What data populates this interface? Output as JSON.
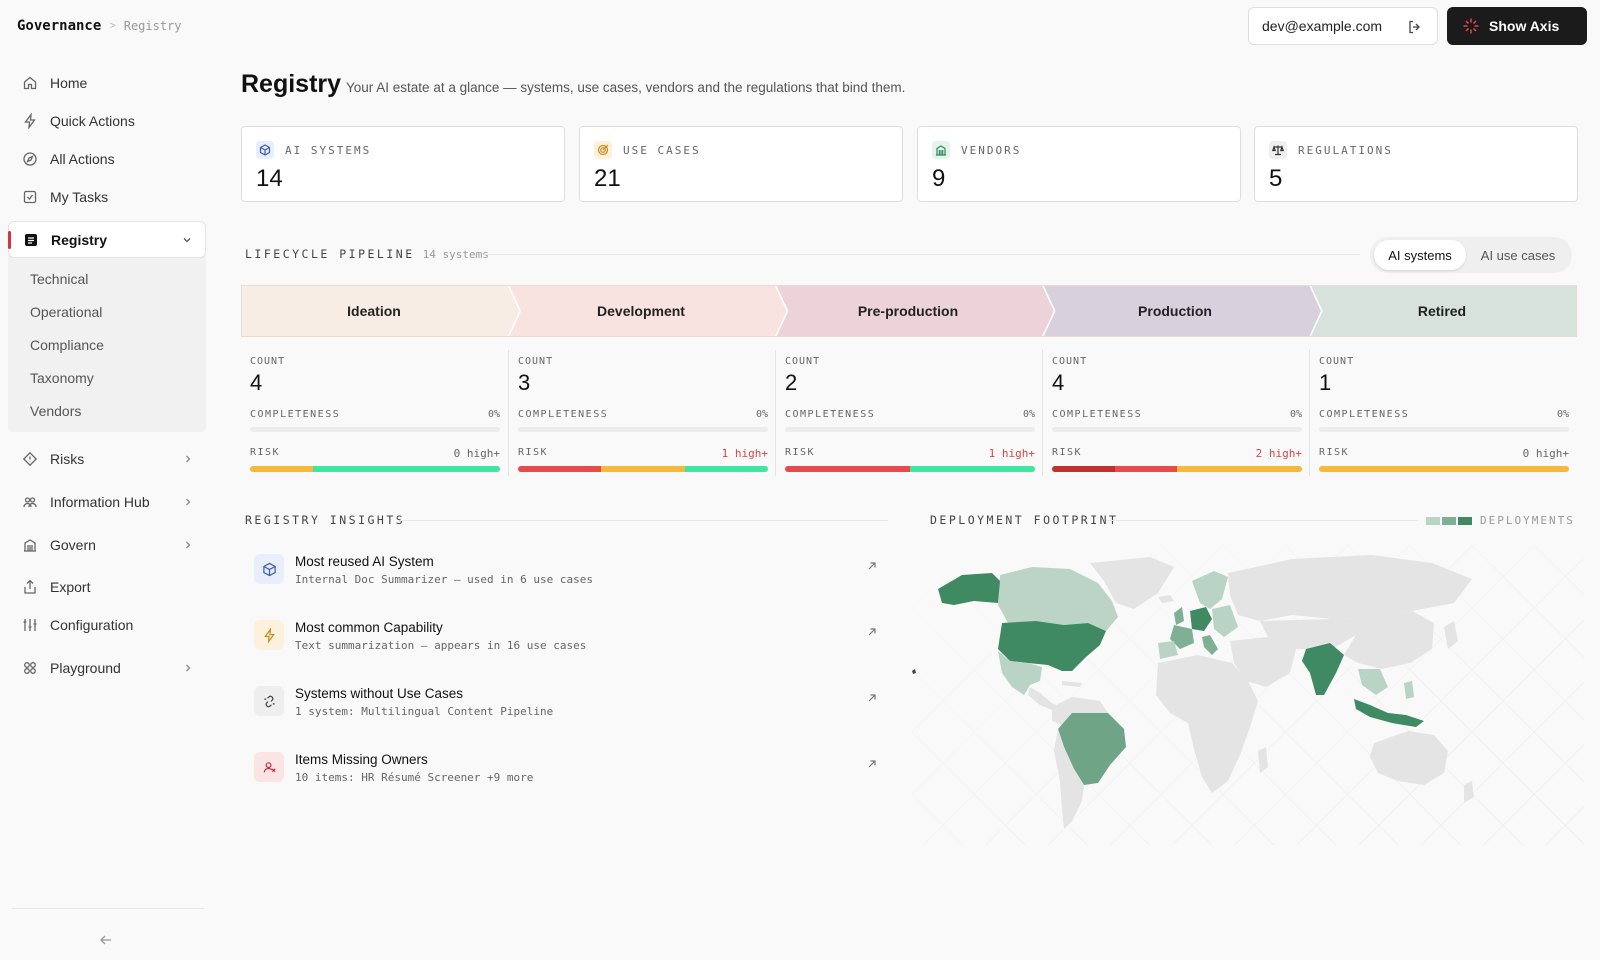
{
  "breadcrumb": {
    "root": "Governance",
    "current": "Registry"
  },
  "sidebar": {
    "items": [
      {
        "label": "Home",
        "icon": "home-icon"
      },
      {
        "label": "Quick Actions",
        "icon": "bolt-icon"
      },
      {
        "label": "All Actions",
        "icon": "compass-icon"
      },
      {
        "label": "My Tasks",
        "icon": "checkbox-icon"
      }
    ],
    "registry": {
      "label": "Registry",
      "children": [
        "Technical",
        "Operational",
        "Compliance",
        "Taxonomy",
        "Vendors"
      ]
    },
    "lower_items": [
      {
        "label": "Risks",
        "icon": "diamond-icon",
        "expandable": true
      },
      {
        "label": "Information Hub",
        "icon": "people-icon",
        "expandable": true
      },
      {
        "label": "Govern",
        "icon": "building-icon",
        "expandable": true
      },
      {
        "label": "Export",
        "icon": "export-icon",
        "expandable": false
      },
      {
        "label": "Configuration",
        "icon": "sliders-icon",
        "expandable": false
      },
      {
        "label": "Playground",
        "icon": "grid-icon",
        "expandable": true
      }
    ]
  },
  "topbar": {
    "user_email": "dev@example.com",
    "show_axis_label": "Show Axis"
  },
  "header": {
    "title": "Registry",
    "subtitle": "Your AI estate at a glance — systems, use cases, vendors and the regulations that bind them."
  },
  "stats": [
    {
      "label": "AI SYSTEMS",
      "value": "14",
      "icon": "cube-icon",
      "tint": "#e8eefb",
      "color": "#3b5bb5"
    },
    {
      "label": "USE CASES",
      "value": "21",
      "icon": "target-icon",
      "tint": "#fbf1dc",
      "color": "#c78a1b"
    },
    {
      "label": "VENDORS",
      "value": "9",
      "icon": "building-icon",
      "tint": "#e4f3ec",
      "color": "#2f8a5c"
    },
    {
      "label": "REGULATIONS",
      "value": "5",
      "icon": "scale-icon",
      "tint": "#eeeeee",
      "color": "#333333"
    }
  ],
  "pipeline": {
    "title": "LIFECYCLE PIPELINE",
    "count": "14 systems",
    "toggle": [
      "AI systems",
      "AI use cases"
    ],
    "active_toggle": 0,
    "count_label": "COUNT",
    "completeness_label": "COMPLETENESS",
    "risk_label": "RISK",
    "stages": [
      {
        "name": "Ideation",
        "color": "#f8ede4",
        "count": "4",
        "completeness": "0%",
        "completeness_value": 0,
        "risk": "0 high+",
        "risk_hot": false,
        "risk_mix": [
          {
            "c": "#f6b93b",
            "v": 0.25
          },
          {
            "c": "#3ee6a0",
            "v": 0.75
          }
        ]
      },
      {
        "name": "Development",
        "color": "#f8e3e1",
        "count": "3",
        "completeness": "0%",
        "completeness_value": 0,
        "risk": "1 high+",
        "risk_hot": true,
        "risk_mix": [
          {
            "c": "#e84a4a",
            "v": 0.333
          },
          {
            "c": "#f6b93b",
            "v": 0.333
          },
          {
            "c": "#3ee6a0",
            "v": 0.334
          }
        ]
      },
      {
        "name": "Pre-production",
        "color": "#ecd3d9",
        "count": "2",
        "completeness": "0%",
        "completeness_value": 0,
        "risk": "1 high+",
        "risk_hot": true,
        "risk_mix": [
          {
            "c": "#e84a4a",
            "v": 0.5
          },
          {
            "c": "#3ee6a0",
            "v": 0.5
          }
        ]
      },
      {
        "name": "Production",
        "color": "#d8d0dd",
        "count": "4",
        "completeness": "0%",
        "completeness_value": 0,
        "risk": "2 high+",
        "risk_hot": true,
        "risk_mix": [
          {
            "c": "#c0302e",
            "v": 0.25
          },
          {
            "c": "#e84a4a",
            "v": 0.25
          },
          {
            "c": "#f6b93b",
            "v": 0.5
          }
        ]
      },
      {
        "name": "Retired",
        "color": "#d7e2dd",
        "count": "1",
        "completeness": "0%",
        "completeness_value": 0,
        "risk": "0 high+",
        "risk_hot": false,
        "risk_mix": [
          {
            "c": "#f6b93b",
            "v": 1.0
          }
        ]
      }
    ]
  },
  "insights": {
    "title": "REGISTRY INSIGHTS",
    "items": [
      {
        "title": "Most reused AI System",
        "desc": "Internal Doc Summarizer — used in 6 use cases",
        "icon": "cube-icon",
        "tint": "#e8eefb",
        "color": "#3b5bb5"
      },
      {
        "title": "Most common Capability",
        "desc": "Text summarization — appears in 16 use cases",
        "icon": "bolt-icon",
        "tint": "#fbf1dc",
        "color": "#c78a1b"
      },
      {
        "title": "Systems without Use Cases",
        "desc": "1 system: Multilingual Content Pipeline",
        "icon": "unlink-icon",
        "tint": "#eeeeee",
        "color": "#444444"
      },
      {
        "title": "Items Missing Owners",
        "desc": "10 items: HR Résumé Screener +9 more",
        "icon": "user-x-icon",
        "tint": "#fbe4e4",
        "color": "#c0303a"
      }
    ]
  },
  "footprint": {
    "title": "DEPLOYMENT FOOTPRINT",
    "legend_label": "DEPLOYMENTS",
    "legend_colors": [
      "#b9d3c4",
      "#7fb096",
      "#3f8a63"
    ],
    "base_color": "#e4e4e4"
  }
}
